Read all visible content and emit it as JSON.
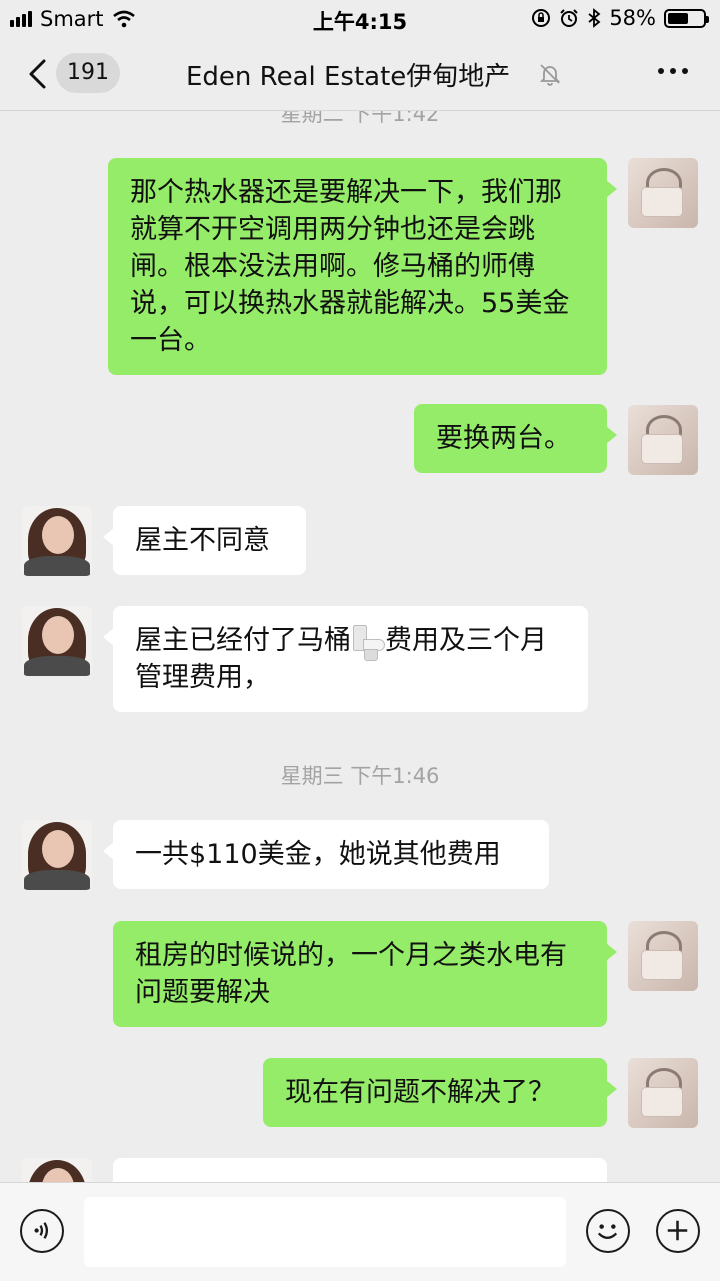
{
  "status_bar": {
    "carrier": "Smart",
    "time": "上午4:15",
    "battery": "58%",
    "battery_level": 0.58
  },
  "nav": {
    "unread_count": "191",
    "title": "Eden Real Estate伊甸地产",
    "icons": [
      "chevron-left-icon",
      "bell-muted-icon",
      "more-icon"
    ]
  },
  "chat": {
    "timestamps": {
      "top_partial": "星期二 下午1:42",
      "wednesday": "星期三 下午1:46"
    },
    "messages": [
      {
        "sender": "self",
        "text": "那个热水器还是要解决一下，我们那就算不开空调用两分钟也还是会跳闸。根本没法用啊。修马桶的师傅说，可以换热水器就能解决。55美金一台。"
      },
      {
        "sender": "self",
        "text": "要换两台。"
      },
      {
        "sender": "other",
        "text": "屋主不同意"
      },
      {
        "sender": "other",
        "text_before": "屋主已经付了马桶",
        "emoji": "toilet-icon",
        "text_after": "费用及三个月管理费用，"
      },
      {
        "sender": "other",
        "text": "一共$110美金，她说其他费用"
      },
      {
        "sender": "self",
        "text": "租房的时候说的，一个月之类水电有问题要解决"
      },
      {
        "sender": "self",
        "text": "现在有问题不解决了？"
      }
    ]
  },
  "input_bar": {
    "value": "",
    "icons": [
      "voice-icon",
      "emoji-icon",
      "plus-icon"
    ]
  },
  "colors": {
    "background": "#ededed",
    "self_bubble": "#95ec69",
    "other_bubble": "#ffffff",
    "timestamp": "#a3a3a3"
  }
}
